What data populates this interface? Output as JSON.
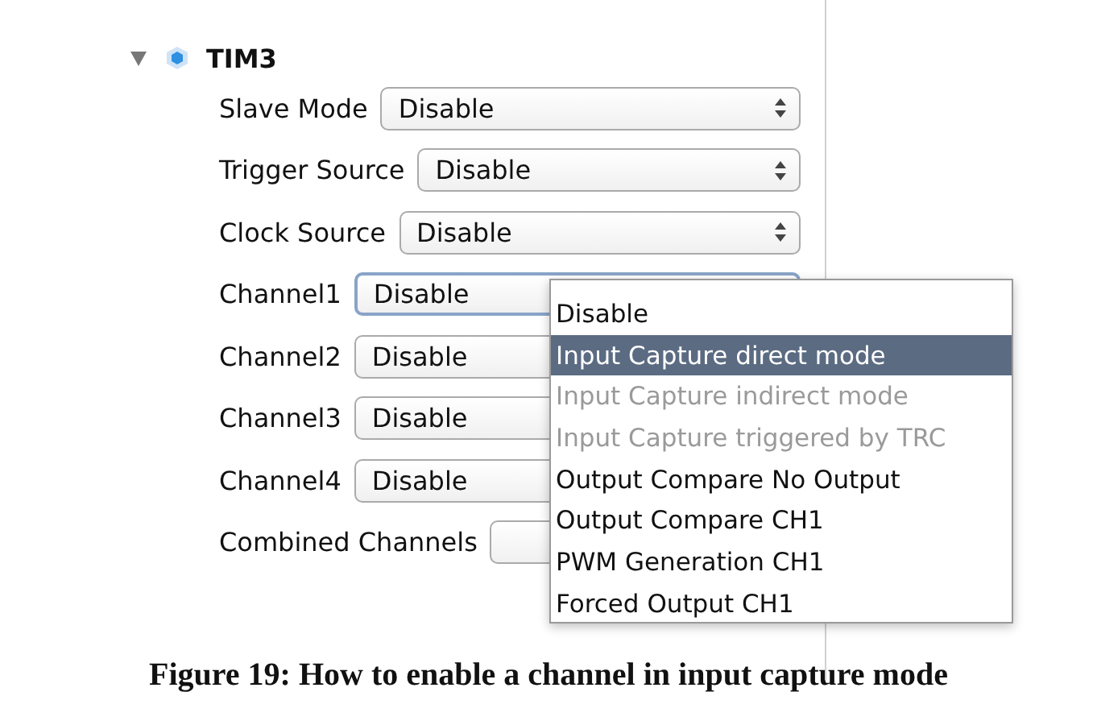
{
  "tree_node": {
    "label": "TIM3",
    "expanded": true
  },
  "settings": [
    {
      "label": "Slave Mode",
      "value": "Disable",
      "open": false
    },
    {
      "label": "Trigger Source",
      "value": "Disable",
      "open": false
    },
    {
      "label": "Clock Source",
      "value": "Disable",
      "open": false
    },
    {
      "label": "Channel1",
      "value": "Disable",
      "open": true
    },
    {
      "label": "Channel2",
      "value": "Disable",
      "open": false
    },
    {
      "label": "Channel3",
      "value": "Disable",
      "open": false
    },
    {
      "label": "Channel4",
      "value": "Disable",
      "open": false
    },
    {
      "label": "Combined Channels",
      "open": false
    }
  ],
  "dropdown": {
    "items": [
      {
        "label": "Disable",
        "selected": false,
        "disabled": false
      },
      {
        "label": "Input Capture direct mode",
        "selected": true,
        "disabled": false
      },
      {
        "label": "Input Capture indirect mode",
        "selected": false,
        "disabled": true
      },
      {
        "label": "Input Capture triggered by TRC",
        "selected": false,
        "disabled": true
      },
      {
        "label": "Output Compare No Output",
        "selected": false,
        "disabled": false
      },
      {
        "label": "Output Compare CH1",
        "selected": false,
        "disabled": false
      },
      {
        "label": "PWM Generation CH1",
        "selected": false,
        "disabled": false
      },
      {
        "label": "Forced Output CH1",
        "selected": false,
        "disabled": false
      }
    ]
  },
  "caption": "Figure 19: How to enable a channel in input capture mode"
}
